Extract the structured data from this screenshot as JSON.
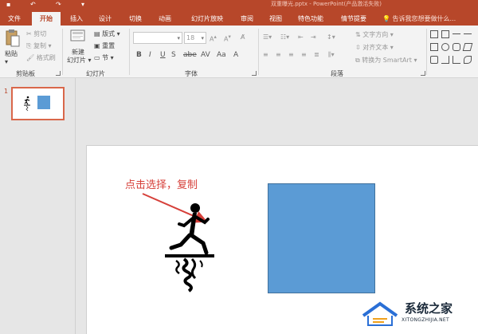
{
  "window": {
    "title": "双重曝光.pptx - PowerPoint(产品激活失败)"
  },
  "tabs": [
    {
      "label": "文件",
      "active": false
    },
    {
      "label": "开始",
      "active": true
    },
    {
      "label": "插入",
      "active": false
    },
    {
      "label": "设计",
      "active": false
    },
    {
      "label": "切换",
      "active": false
    },
    {
      "label": "动画",
      "active": false
    },
    {
      "label": "幻灯片放映",
      "active": false
    },
    {
      "label": "审阅",
      "active": false
    },
    {
      "label": "视图",
      "active": false
    },
    {
      "label": "特色功能",
      "active": false
    },
    {
      "label": "情节提要",
      "active": false
    }
  ],
  "tell_me": "告诉我您想要做什么...",
  "ribbon": {
    "clipboard": {
      "paste": "粘贴",
      "cut": "剪切",
      "copy": "复制",
      "format_painter": "格式刷",
      "group_label": "剪贴板"
    },
    "slides": {
      "new_slide_line1": "新建",
      "new_slide_line2": "幻灯片",
      "layout": "版式",
      "reset": "重置",
      "section": "节",
      "group_label": "幻灯片"
    },
    "font": {
      "size": "18",
      "group_label": "字体"
    },
    "paragraph": {
      "text_direction": "文字方向",
      "align_text": "对齐文本",
      "convert_smartart": "转换为 SmartArt",
      "group_label": "段落"
    }
  },
  "thumbnails": [
    {
      "number": "1"
    }
  ],
  "slide": {
    "annotation": "点击选择，复制"
  },
  "watermark": {
    "text": "系统之家",
    "sub": "XITONGZHIJIA.NET"
  },
  "colors": {
    "accent": "#b7472a",
    "shape_fill": "#5b9bd5",
    "annotation": "#d6403a"
  }
}
